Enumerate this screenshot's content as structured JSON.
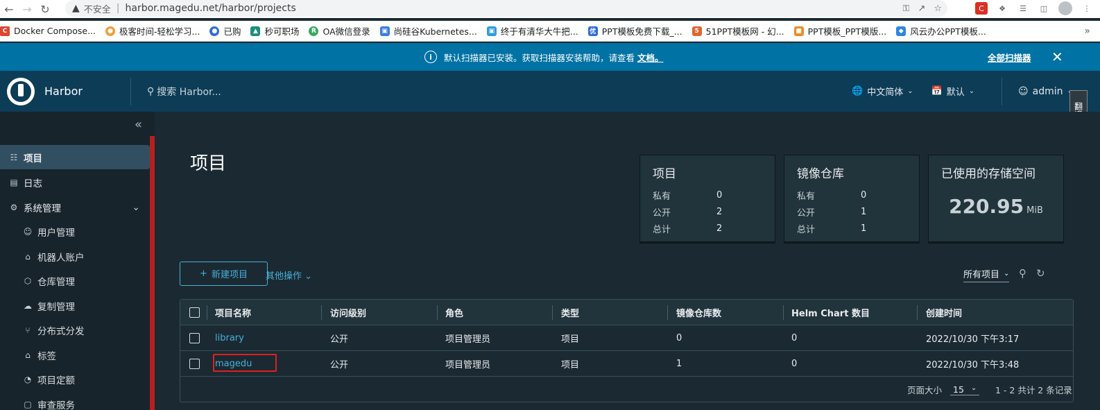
{
  "browser": {
    "insecure_label": "不安全",
    "url": "harbor.magedu.net/harbor/projects",
    "bookmarks": [
      {
        "label": "Docker Compose...",
        "color": "#e0442f",
        "glyph": "C"
      },
      {
        "label": "极客时间-轻松学习...",
        "color": "#f29d38",
        "glyph": "●"
      },
      {
        "label": "已购",
        "color": "#2f6ed6",
        "glyph": "●"
      },
      {
        "label": "秒可职场",
        "color": "#1b8f7b",
        "glyph": "▲"
      },
      {
        "label": "OA微信登录",
        "color": "#3aa864",
        "glyph": "R"
      },
      {
        "label": "尚硅谷Kubernetes...",
        "color": "#3b7de0",
        "glyph": "▣"
      },
      {
        "label": "终于有清华大牛把...",
        "color": "#2b9de0",
        "glyph": "▣"
      },
      {
        "label": "PPT模板免费下载_...",
        "color": "#2f6ed6",
        "glyph": "优"
      },
      {
        "label": "51PPT模板网 - 幻...",
        "color": "#e0662f",
        "glyph": "5"
      },
      {
        "label": "PPT模板_PPT模版...",
        "color": "#f08a24",
        "glyph": "■"
      },
      {
        "label": "风云办公PPT模板...",
        "color": "#2f86e0",
        "glyph": "◆"
      }
    ]
  },
  "banner": {
    "message": "默认扫描器已安装。获取扫描器安装帮助，请查看",
    "link": "文档。",
    "all_scanners": "全部扫描器"
  },
  "header": {
    "brand": "Harbor",
    "search_placeholder": "搜索 Harbor...",
    "language": "中文简体",
    "datetime_format": "默认",
    "user": "admin",
    "side_tab": "翻译插件"
  },
  "sidebar": {
    "items": [
      {
        "label": "项目",
        "icon": "☷"
      },
      {
        "label": "日志",
        "icon": "▤"
      },
      {
        "label": "系统管理",
        "icon": "⚙"
      },
      {
        "label": "用户管理",
        "icon": "☺"
      },
      {
        "label": "机器人账户",
        "icon": "⌂"
      },
      {
        "label": "仓库管理",
        "icon": "⬡"
      },
      {
        "label": "复制管理",
        "icon": "☁"
      },
      {
        "label": "分布式分发",
        "icon": "⑂"
      },
      {
        "label": "标签",
        "icon": "⌂"
      },
      {
        "label": "项目定额",
        "icon": "◔"
      },
      {
        "label": "审查服务",
        "icon": "▢"
      }
    ]
  },
  "main": {
    "title": "项目",
    "cards": [
      {
        "title": "项目",
        "rows": [
          {
            "k": "私有",
            "v": "0"
          },
          {
            "k": "公开",
            "v": "2"
          },
          {
            "k": "总计",
            "v": "2"
          }
        ]
      },
      {
        "title": "镜像仓库",
        "rows": [
          {
            "k": "私有",
            "v": "0"
          },
          {
            "k": "公开",
            "v": "1"
          },
          {
            "k": "总计",
            "v": "1"
          }
        ]
      }
    ],
    "storage": {
      "title": "已使用的存储空间",
      "value": "220.95",
      "unit": "MiB"
    },
    "new_project_label": "新建项目",
    "other_actions_label": "其他操作",
    "filter_label": "所有项目",
    "columns": [
      "项目名称",
      "访问级别",
      "角色",
      "类型",
      "镜像仓库数",
      "Helm Chart 数目",
      "创建时间"
    ],
    "rows": [
      [
        "library",
        "公开",
        "项目管理员",
        "项目",
        "0",
        "0",
        "2022/10/30 下午3:17"
      ],
      [
        "magedu",
        "公开",
        "项目管理员",
        "项目",
        "1",
        "0",
        "2022/10/30 下午3:48"
      ]
    ],
    "page_size_label": "页面大小",
    "page_size": "15",
    "records": "1 - 2 共计 2 条记录"
  }
}
